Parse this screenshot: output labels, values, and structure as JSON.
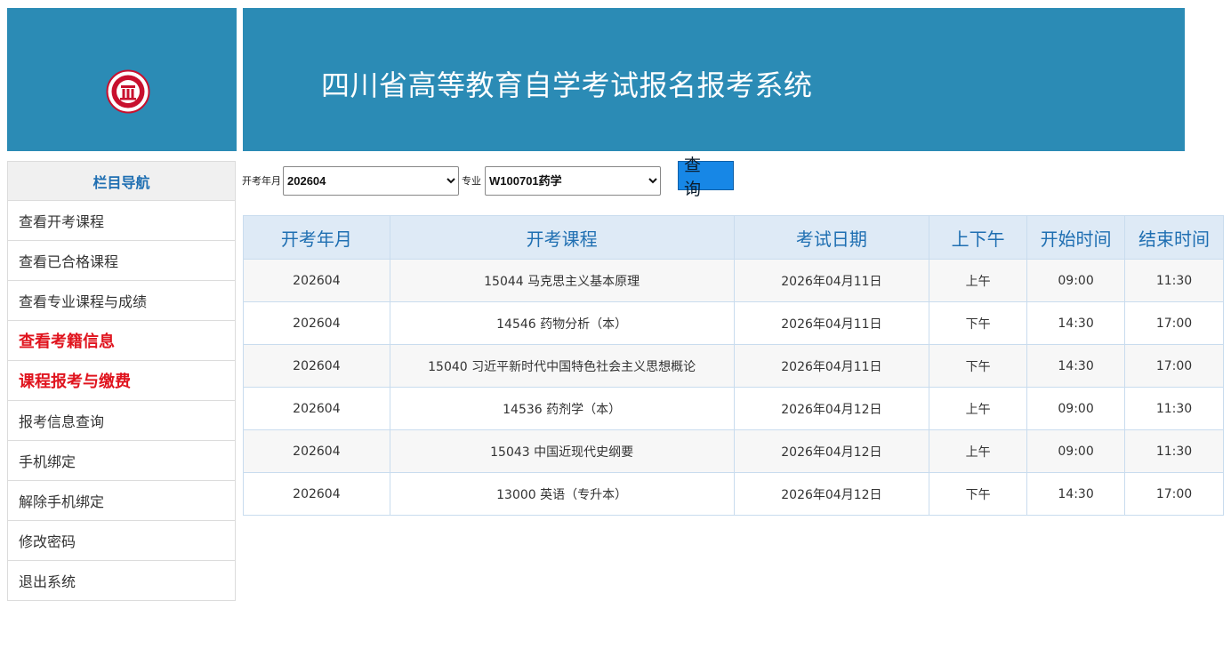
{
  "header": {
    "title": "四川省高等教育自学考试报名报考系统",
    "brand_color": "#2b8bb5",
    "logo_icon": "university-seal-icon"
  },
  "sidebar": {
    "title": "栏目导航",
    "items": [
      {
        "label": "查看开考课程",
        "highlight": false
      },
      {
        "label": "查看已合格课程",
        "highlight": false
      },
      {
        "label": "查看专业课程与成绩",
        "highlight": false
      },
      {
        "label": "查看考籍信息",
        "highlight": true
      },
      {
        "label": "课程报考与缴费",
        "highlight": true
      },
      {
        "label": "报考信息查询",
        "highlight": false
      },
      {
        "label": "手机绑定",
        "highlight": false
      },
      {
        "label": "解除手机绑定",
        "highlight": false
      },
      {
        "label": "修改密码",
        "highlight": false
      },
      {
        "label": "退出系统",
        "highlight": false
      }
    ]
  },
  "filters": {
    "month_label": "开考年月",
    "month_value": "202604",
    "major_label": "专业",
    "major_value": "W100701药学",
    "query_button": "查 询"
  },
  "table": {
    "columns": [
      "开考年月",
      "开考课程",
      "考试日期",
      "上下午",
      "开始时间",
      "结束时间"
    ],
    "rows": [
      [
        "202604",
        "15044 马克思主义基本原理",
        "2026年04月11日",
        "上午",
        "09:00",
        "11:30"
      ],
      [
        "202604",
        "14546 药物分析（本）",
        "2026年04月11日",
        "下午",
        "14:30",
        "17:00"
      ],
      [
        "202604",
        "15040 习近平新时代中国特色社会主义思想概论",
        "2026年04月11日",
        "下午",
        "14:30",
        "17:00"
      ],
      [
        "202604",
        "14536 药剂学（本）",
        "2026年04月12日",
        "上午",
        "09:00",
        "11:30"
      ],
      [
        "202604",
        "15043 中国近现代史纲要",
        "2026年04月12日",
        "上午",
        "09:00",
        "11:30"
      ],
      [
        "202604",
        "13000 英语（专升本）",
        "2026年04月12日",
        "下午",
        "14:30",
        "17:00"
      ]
    ]
  },
  "colors": {
    "header_bg": "#2b8bb5",
    "highlight_text": "#e0141e",
    "table_header_bg": "#deeaf6",
    "table_header_text": "#1f6fb2",
    "query_button_bg": "#1787e6"
  }
}
